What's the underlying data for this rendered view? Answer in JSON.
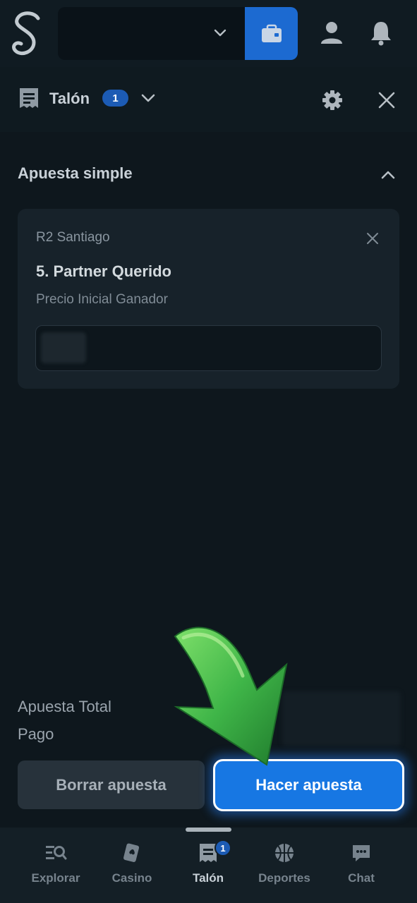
{
  "header": {
    "logo_icon": "script-s-logo-icon",
    "wallet_icon": "wallet-icon",
    "user_icon": "user-icon",
    "bell_icon": "bell-icon",
    "accent_color": "#1c6ad1"
  },
  "slip": {
    "title": "Talón",
    "count": "1"
  },
  "section": {
    "title": "Apuesta simple"
  },
  "bet": {
    "race": "R2 Santiago",
    "runner": "5. Partner Querido",
    "market": "Precio Inicial Ganador"
  },
  "footer": {
    "total_label": "Apuesta Total",
    "pay_label": "Pago",
    "clear_label": "Borrar apuesta",
    "place_label": "Hacer apuesta",
    "place_color": "#1777e3"
  },
  "nav": {
    "items": [
      {
        "label": "Explorar",
        "icon": "explore-icon"
      },
      {
        "label": "Casino",
        "icon": "cards-icon"
      },
      {
        "label": "Talón",
        "icon": "betslip-icon",
        "badge": "1"
      },
      {
        "label": "Deportes",
        "icon": "basketball-icon"
      },
      {
        "label": "Chat",
        "icon": "chat-icon"
      }
    ]
  }
}
